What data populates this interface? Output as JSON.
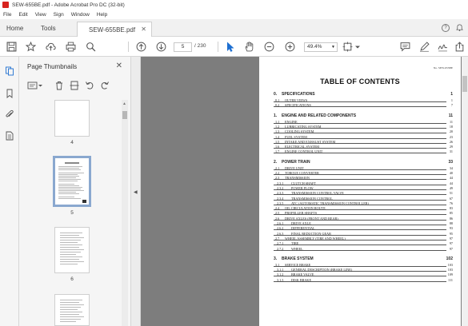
{
  "window": {
    "title": "SEW-655BE.pdf - Adobe Acrobat Pro DC (32-bit)"
  },
  "menu": [
    "File",
    "Edit",
    "View",
    "Sign",
    "Window",
    "Help"
  ],
  "tabs": {
    "home": "Home",
    "tools": "Tools",
    "document": "SEW-655BE.pdf"
  },
  "toolbar": {
    "page_current": "5",
    "page_total": "/ 230",
    "zoom": "49.4%"
  },
  "icons": {
    "save": "save-icon",
    "bookmark": "star-icon",
    "upload": "cloud-upload-icon",
    "print": "print-icon",
    "search": "search-icon",
    "prev": "page-up-icon",
    "next": "page-down-icon",
    "select": "pointer-icon",
    "hand": "hand-icon",
    "zoom_out": "zoom-out-icon",
    "zoom_in": "zoom-in-icon",
    "comment": "comment-icon",
    "pen": "pen-icon",
    "sign": "sign-icon",
    "share": "share-icon"
  },
  "panel": {
    "title": "Page Thumbnails",
    "thumbnails": [
      {
        "label": "4"
      },
      {
        "label": "5"
      },
      {
        "label": "6"
      }
    ]
  },
  "document": {
    "doc_no": "No. SEW-655BE",
    "heading": "TABLE OF CONTENTS",
    "rows": [
      {
        "num": "0.",
        "text": "SPECIFICATIONS",
        "page": "1",
        "level": "sec"
      },
      {
        "num": "0.1",
        "text": "OUTER VIEWS",
        "page": "1",
        "level": "lvl2"
      },
      {
        "num": "0.2",
        "text": "SPECIFICATIONS",
        "page": "7",
        "level": "lvl2"
      },
      {
        "num": "",
        "text": "",
        "page": "",
        "level": "gap"
      },
      {
        "num": "1.",
        "text": "ENGINE AND RELATED COMPONENTS",
        "page": "11",
        "level": "sec"
      },
      {
        "num": "1.1",
        "text": "ENGINE",
        "page": "11",
        "level": "lvl2"
      },
      {
        "num": "1.2",
        "text": "LUBRICATING SYSTEM",
        "page": "18",
        "level": "lvl2"
      },
      {
        "num": "1.3",
        "text": "COOLING SYSTEM",
        "page": "20",
        "level": "lvl2"
      },
      {
        "num": "1.4",
        "text": "FUEL SYSTEM",
        "page": "23",
        "level": "lvl2"
      },
      {
        "num": "1.5",
        "text": "INTAKE AND EXHAUST SYSTEM",
        "page": "26",
        "level": "lvl2"
      },
      {
        "num": "1.6",
        "text": "ELECTRICAL SYSTEM",
        "page": "29",
        "level": "lvl2"
      },
      {
        "num": "1.7",
        "text": "ENGINE CONTROL UNIT",
        "page": "31",
        "level": "lvl2"
      },
      {
        "num": "",
        "text": "",
        "page": "",
        "level": "gap"
      },
      {
        "num": "2.",
        "text": "POWER TRAIN",
        "page": "33",
        "level": "sec"
      },
      {
        "num": "2.1",
        "text": "DRIVE UNIT",
        "page": "34",
        "level": "lvl2"
      },
      {
        "num": "2.2",
        "text": "TORQUE CONVERTER",
        "page": "40",
        "level": "lvl2"
      },
      {
        "num": "2.3",
        "text": "TRANSMISSION",
        "page": "44",
        "level": "lvl2"
      },
      {
        "num": "2.3.1",
        "text": "CLUTCH SHAFT",
        "page": "44",
        "level": "lvl3"
      },
      {
        "num": "2.3.2",
        "text": "POWER FLOW",
        "page": "49",
        "level": "lvl3"
      },
      {
        "num": "2.3.3",
        "text": "TRANSMISSION CONTROL VALVE",
        "page": "51",
        "level": "lvl3"
      },
      {
        "num": "2.3.4",
        "text": "TRANSMISSION CONTROL",
        "page": "67",
        "level": "lvl3"
      },
      {
        "num": "2.3.5",
        "text": "ATC (AUTOMATIC TRANSMISSION CONTROLLER)",
        "page": "76",
        "level": "lvl3"
      },
      {
        "num": "2.4",
        "text": "OIL CIRCULATION ROUTE",
        "page": "83",
        "level": "lvl2"
      },
      {
        "num": "2.5",
        "text": "PROPELLER SHAFTS",
        "page": "85",
        "level": "lvl2"
      },
      {
        "num": "2.6",
        "text": "DRIVE AXLES (FRONT AND REAR)",
        "page": "86",
        "level": "lvl2"
      },
      {
        "num": "2.6.1",
        "text": "DRIVE AXLE",
        "page": "88",
        "level": "lvl3"
      },
      {
        "num": "2.6.2",
        "text": "DIFFERENTIAL",
        "page": "93",
        "level": "lvl3"
      },
      {
        "num": "2.6.3",
        "text": "FINAL REDUCTION GEAR",
        "page": "95",
        "level": "lvl3"
      },
      {
        "num": "2.7",
        "text": "WHEEL ASSEMBLY (TIRE AND WHEEL)",
        "page": "97",
        "level": "lvl2"
      },
      {
        "num": "2.7.1",
        "text": "TIRE",
        "page": "97",
        "level": "lvl3"
      },
      {
        "num": "2.7.2",
        "text": "WHEEL",
        "page": "97",
        "level": "lvl3"
      },
      {
        "num": "",
        "text": "",
        "page": "",
        "level": "gap"
      },
      {
        "num": "3.",
        "text": "BRAKE SYSTEM",
        "page": "102",
        "level": "sec"
      },
      {
        "num": "3.1",
        "text": "SERVICE BRAKE",
        "page": "103",
        "level": "lvl2"
      },
      {
        "num": "3.1.1",
        "text": "GENERAL DESCRIPTION (BRAKE LINE)",
        "page": "103",
        "level": "lvl3"
      },
      {
        "num": "3.1.2",
        "text": "BRAKE VALVE",
        "page": "109",
        "level": "lvl3"
      },
      {
        "num": "3.1.3",
        "text": "DISK BRAKE",
        "page": "111",
        "level": "lvl3"
      }
    ]
  }
}
